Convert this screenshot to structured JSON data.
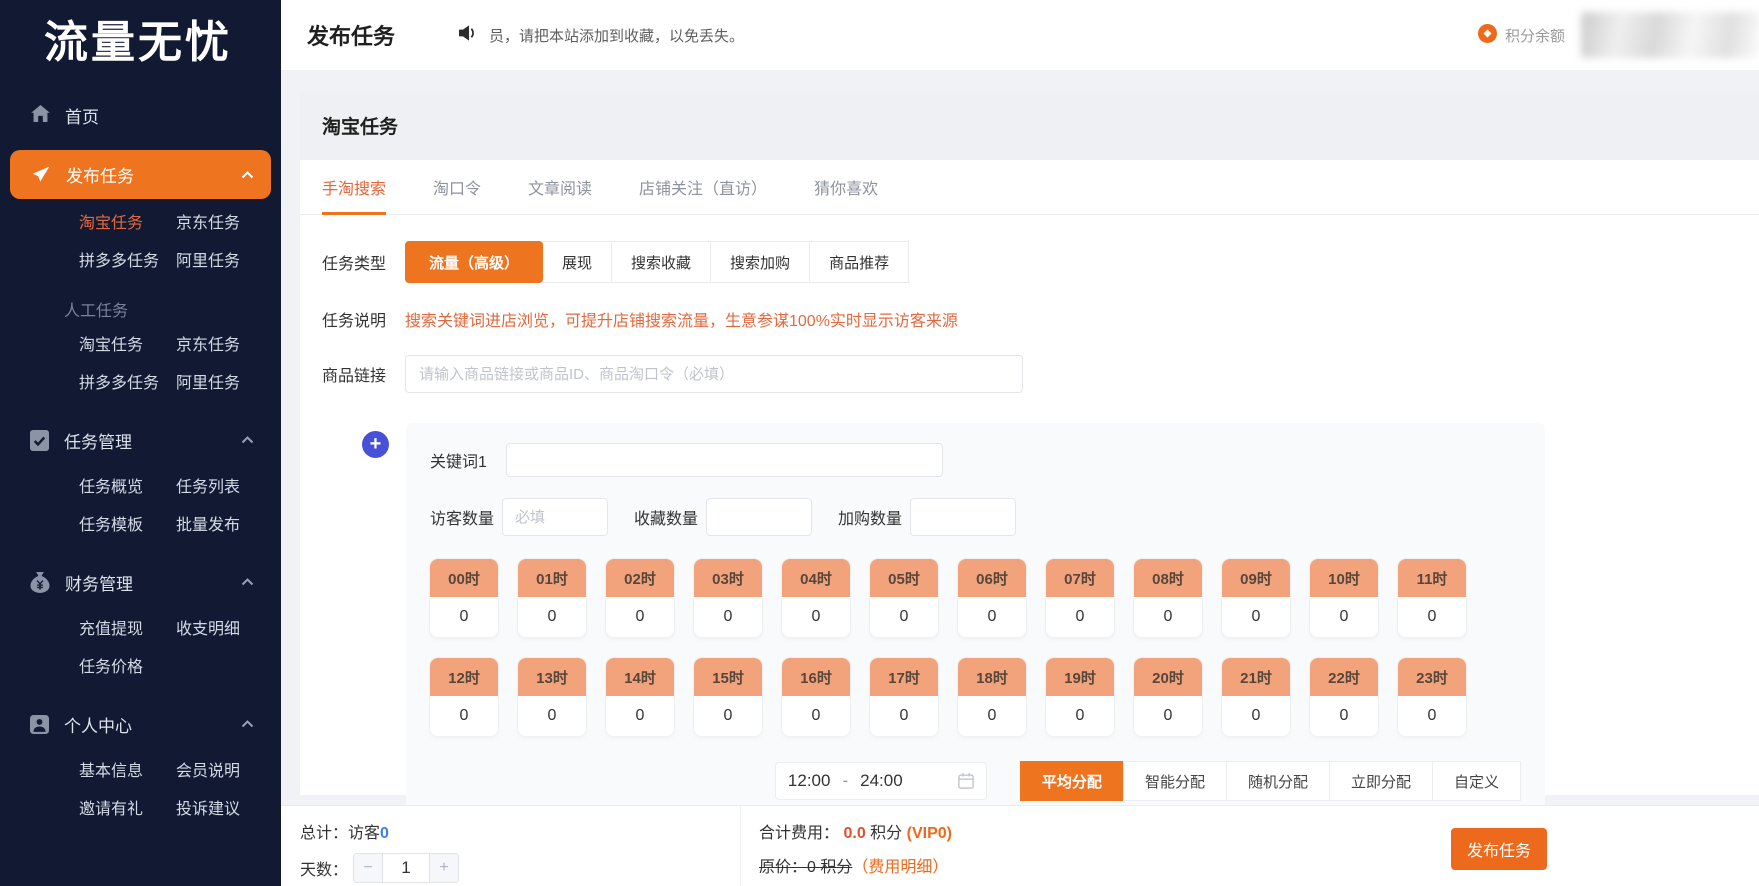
{
  "colors": {
    "accent_orange": "#ee7420",
    "button_orange": "#ed6a1d",
    "sidebar_bg": "#121a33",
    "hour_header_salmon": "#f2a37c",
    "link_orange": "#e2693e",
    "value_blue": "#3d7fe8",
    "plus_indigo": "#4950d8",
    "cost_red": "#e0512f"
  },
  "sidebar": {
    "logo": "流量无忧",
    "home": "首页",
    "groups": [
      {
        "label": "发布任务",
        "links": [
          "淘宝任务",
          "京东任务",
          "拼多多任务",
          "阿里任务"
        ],
        "active_link": "淘宝任务"
      },
      {
        "label": "人工任务",
        "links": [
          "淘宝任务",
          "京东任务",
          "拼多多任务",
          "阿里任务"
        ]
      },
      {
        "label": "任务管理",
        "links": [
          "任务概览",
          "任务列表",
          "任务模板",
          "批量发布"
        ]
      },
      {
        "label": "财务管理",
        "links": [
          "充值提现",
          "收支明细",
          "任务价格"
        ]
      },
      {
        "label": "个人中心",
        "links": [
          "基本信息",
          "会员说明",
          "邀请有礼",
          "投诉建议"
        ]
      }
    ]
  },
  "topbar": {
    "title": "发布任务",
    "announcement": "员，请把本站添加到收藏，以免丢失。",
    "points_label": "积分余额"
  },
  "panel": {
    "title": "淘宝任务",
    "tabs": [
      "手淘搜索",
      "淘口令",
      "文章阅读",
      "店铺关注（直访）",
      "猜你喜欢"
    ],
    "active_tab": "手淘搜索"
  },
  "form": {
    "task_type_label": "任务类型",
    "task_types": [
      "流量（高级）",
      "展现",
      "搜索收藏",
      "搜索加购",
      "商品推荐"
    ],
    "active_task_type": "流量（高级）",
    "task_desc_label": "任务说明",
    "task_desc": "搜索关键词进店浏览，可提升店铺搜索流量，生意参谋100%实时显示访客来源",
    "product_link_label": "商品链接",
    "product_link_placeholder": "请输入商品链接或商品ID、商品淘口令（必填）",
    "plus_label": "+",
    "keyword_label": "关键词1",
    "visitor_label": "访客数量",
    "visitor_placeholder": "必填",
    "favorite_label": "收藏数量",
    "cart_label": "加购数量",
    "hours": [
      {
        "label": "00时",
        "value": "0"
      },
      {
        "label": "01时",
        "value": "0"
      },
      {
        "label": "02时",
        "value": "0"
      },
      {
        "label": "03时",
        "value": "0"
      },
      {
        "label": "04时",
        "value": "0"
      },
      {
        "label": "05时",
        "value": "0"
      },
      {
        "label": "06时",
        "value": "0"
      },
      {
        "label": "07时",
        "value": "0"
      },
      {
        "label": "08时",
        "value": "0"
      },
      {
        "label": "09时",
        "value": "0"
      },
      {
        "label": "10时",
        "value": "0"
      },
      {
        "label": "11时",
        "value": "0"
      },
      {
        "label": "12时",
        "value": "0"
      },
      {
        "label": "13时",
        "value": "0"
      },
      {
        "label": "14时",
        "value": "0"
      },
      {
        "label": "15时",
        "value": "0"
      },
      {
        "label": "16时",
        "value": "0"
      },
      {
        "label": "17时",
        "value": "0"
      },
      {
        "label": "18时",
        "value": "0"
      },
      {
        "label": "19时",
        "value": "0"
      },
      {
        "label": "20时",
        "value": "0"
      },
      {
        "label": "21时",
        "value": "0"
      },
      {
        "label": "22时",
        "value": "0"
      },
      {
        "label": "23时",
        "value": "0"
      }
    ],
    "time_start": "12:00",
    "time_dash": "-",
    "time_end": "24:00",
    "distribution": [
      "平均分配",
      "智能分配",
      "随机分配",
      "立即分配",
      "自定义"
    ],
    "active_distribution": "平均分配"
  },
  "footer": {
    "total_label": "总计：访客",
    "total_value": "0",
    "days_label": "天数：",
    "minus": "−",
    "days_value": "1",
    "plus": "+",
    "cost_label": "合计费用：",
    "cost_value": "0.0",
    "cost_unit": "积分",
    "vip": "(VIP0)",
    "original_price": "原价：0 积分",
    "detail_link": "（费用明细）",
    "publish_button": "发布任务"
  }
}
